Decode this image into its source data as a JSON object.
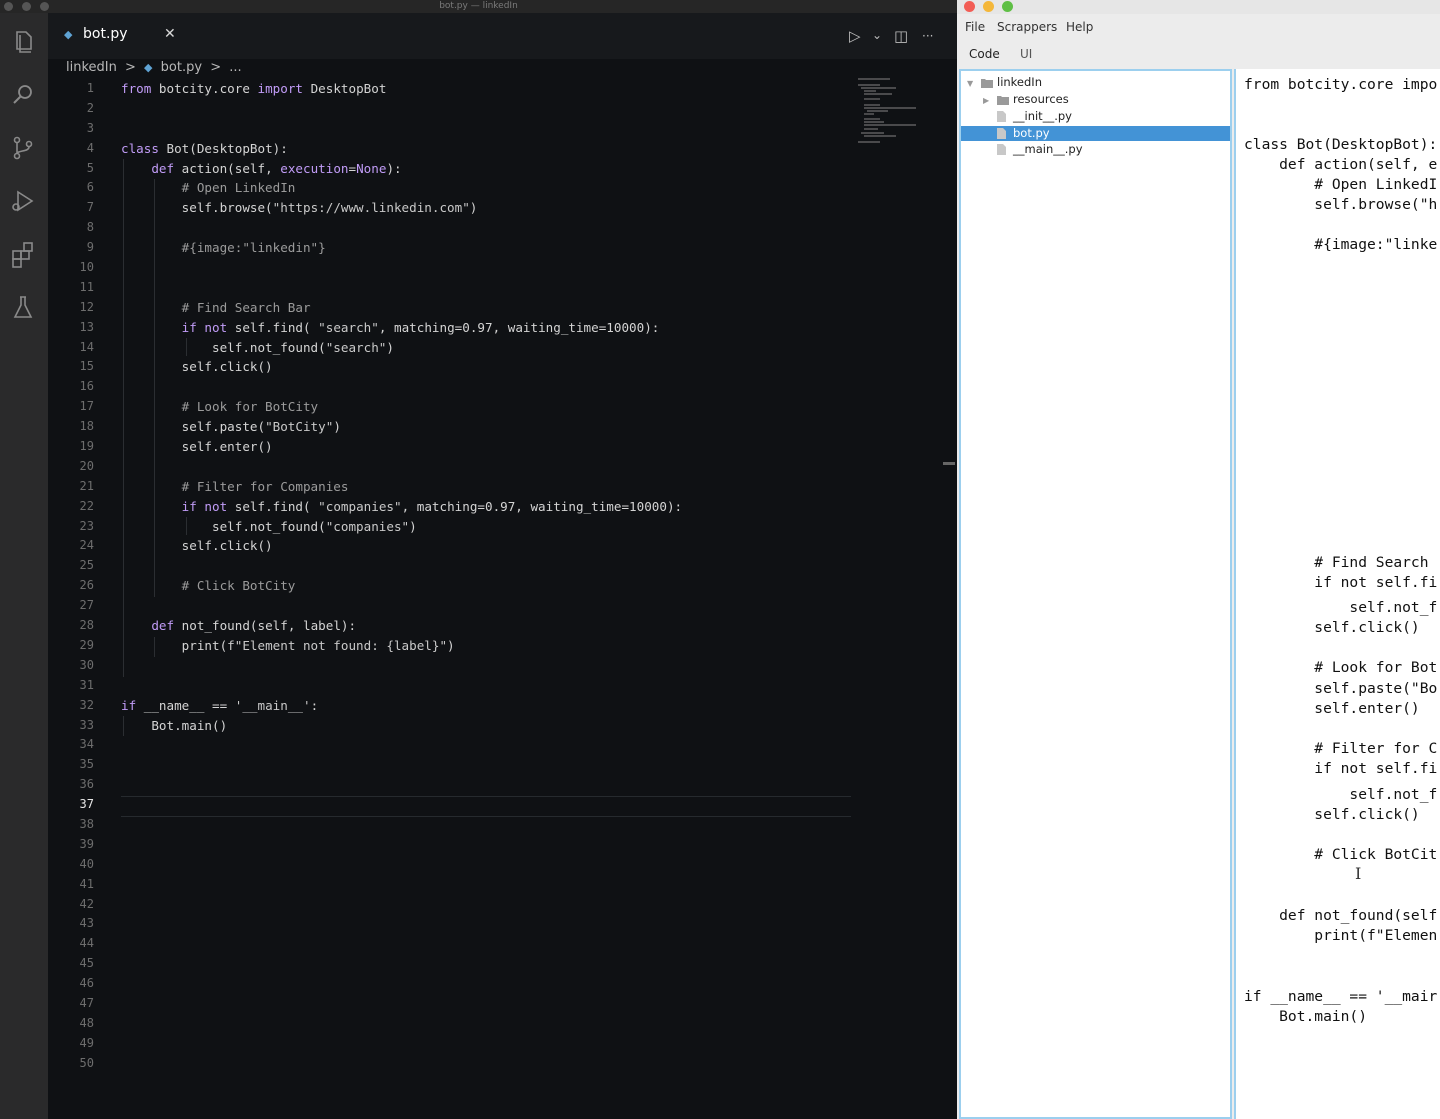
{
  "vscode": {
    "window_title": "bot.py — linkedIn",
    "tab": {
      "label": "bot.py",
      "close": "✕"
    },
    "toolbar": {
      "run": "▷",
      "run_dropdown": "⌄",
      "split": "◫",
      "more": "···"
    },
    "breadcrumb": {
      "folder": "linkedIn",
      "sep": ">",
      "file": "bot.py",
      "more": "..."
    },
    "current_line": 37,
    "line_numbers": [
      "1",
      "2",
      "3",
      "4",
      "5",
      "6",
      "7",
      "8",
      "9",
      "10",
      "11",
      "12",
      "13",
      "14",
      "15",
      "16",
      "17",
      "18",
      "19",
      "20",
      "21",
      "22",
      "23",
      "24",
      "25",
      "26",
      "27",
      "28",
      "29",
      "30",
      "31",
      "32",
      "33",
      "34",
      "35",
      "36",
      "37",
      "38",
      "39",
      "40",
      "41",
      "42",
      "43",
      "44",
      "45",
      "46",
      "47",
      "48",
      "49",
      "50"
    ],
    "code_lines": [
      [
        [
          "kw",
          "from"
        ],
        [
          "t",
          " botcity.core "
        ],
        [
          "kw",
          "import"
        ],
        [
          "t",
          " DesktopBot"
        ]
      ],
      [],
      [],
      [
        [
          "kw",
          "class"
        ],
        [
          "t",
          " Bot(DesktopBot):"
        ]
      ],
      [
        [
          "t",
          "    "
        ],
        [
          "kw",
          "def"
        ],
        [
          "t",
          " action(self, "
        ],
        [
          "kw",
          "execution"
        ],
        [
          "t",
          "="
        ],
        [
          "kw",
          "None"
        ],
        [
          "t",
          "):"
        ]
      ],
      [
        [
          "cm",
          "        # Open LinkedIn"
        ]
      ],
      [
        [
          "t",
          "        self.browse("
        ],
        [
          "st",
          "\"https://www.linkedin.com\""
        ],
        [
          "t",
          ")"
        ]
      ],
      [],
      [
        [
          "cm",
          "        #{image:\"linkedin\"}"
        ]
      ],
      [],
      [],
      [
        [
          "cm",
          "        # Find Search Bar"
        ]
      ],
      [
        [
          "t",
          "        "
        ],
        [
          "kw",
          "if not"
        ],
        [
          "t",
          " self.find( "
        ],
        [
          "st",
          "\"search\""
        ],
        [
          "t",
          ", matching=0.97, waiting_time=10000):"
        ]
      ],
      [
        [
          "t",
          "            self.not_found("
        ],
        [
          "st",
          "\"search\""
        ],
        [
          "t",
          ")"
        ]
      ],
      [
        [
          "t",
          "        self.click()"
        ]
      ],
      [],
      [
        [
          "cm",
          "        # Look for BotCity"
        ]
      ],
      [
        [
          "t",
          "        self.paste("
        ],
        [
          "st",
          "\"BotCity\""
        ],
        [
          "t",
          ")"
        ]
      ],
      [
        [
          "t",
          "        self.enter()"
        ]
      ],
      [],
      [
        [
          "cm",
          "        # Filter for Companies"
        ]
      ],
      [
        [
          "t",
          "        "
        ],
        [
          "kw",
          "if not"
        ],
        [
          "t",
          " self.find( "
        ],
        [
          "st",
          "\"companies\""
        ],
        [
          "t",
          ", matching=0.97, waiting_time=10000):"
        ]
      ],
      [
        [
          "t",
          "            self.not_found("
        ],
        [
          "st",
          "\"companies\""
        ],
        [
          "t",
          ")"
        ]
      ],
      [
        [
          "t",
          "        self.click()"
        ]
      ],
      [],
      [
        [
          "cm",
          "        # Click BotCity"
        ]
      ],
      [],
      [
        [
          "t",
          "    "
        ],
        [
          "kw",
          "def"
        ],
        [
          "t",
          " not_found(self, label):"
        ]
      ],
      [
        [
          "t",
          "        print("
        ],
        [
          "st",
          "f\"Element not found: {label}\""
        ],
        [
          "t",
          ")"
        ]
      ],
      [],
      [],
      [
        [
          "kw",
          "if"
        ],
        [
          "t",
          " __name__ == "
        ],
        [
          "st",
          "'__main__'"
        ],
        [
          "t",
          ":"
        ]
      ],
      [
        [
          "t",
          "    Bot.main()"
        ]
      ]
    ]
  },
  "botcity": {
    "menu": [
      "File",
      "Scrappers",
      "Help"
    ],
    "tabs": {
      "code": "Code",
      "ui": "UI"
    },
    "tree": [
      {
        "label": "linkedIn",
        "toggle": "▼",
        "indent": 0,
        "icon": "folder"
      },
      {
        "label": "resources",
        "toggle": "▶",
        "indent": 1,
        "icon": "folder"
      },
      {
        "label": "__init__.py",
        "toggle": "",
        "indent": 1,
        "icon": "file"
      },
      {
        "label": "bot.py",
        "toggle": "",
        "indent": 1,
        "icon": "file",
        "selected": true
      },
      {
        "label": "__main__.py",
        "toggle": "",
        "indent": 1,
        "icon": "file"
      }
    ],
    "editor_lines": [
      "from botcity.core impo",
      "class Bot(DesktopBot):",
      "    def action(self, e",
      "        # Open LinkedI",
      "        self.browse(\"h",
      "        #{image:\"linke",
      "        # Find Search",
      "        if not self.fi",
      "            self.not_f",
      "        self.click()",
      "        # Look for Bot",
      "        self.paste(\"Bo",
      "        self.enter()",
      "        # Filter for C",
      "        if not self.fi",
      "            self.not_f",
      "        self.click()",
      "        # Click BotCit",
      "    def not_found(self",
      "        print(f\"Elemen",
      "if __name__ == '__mair",
      "    Bot.main()"
    ]
  }
}
